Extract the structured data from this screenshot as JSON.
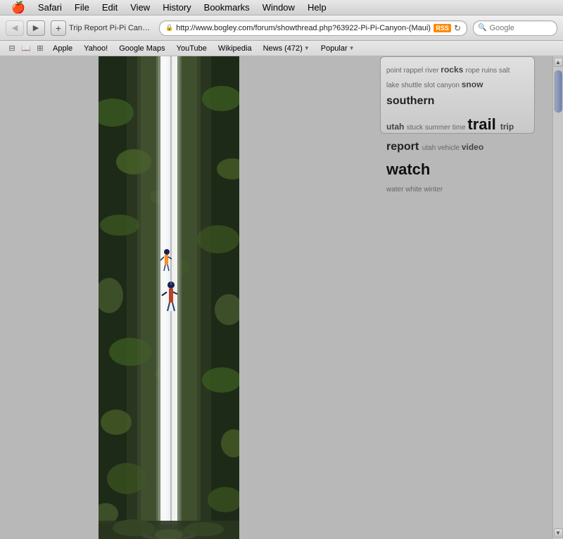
{
  "menubar": {
    "apple": "🍎",
    "items": [
      "Safari",
      "File",
      "Edit",
      "View",
      "History",
      "Bookmarks",
      "Window",
      "Help"
    ]
  },
  "toolbar": {
    "back_label": "◀",
    "forward_label": "▶",
    "plus_label": "+",
    "address": "http://www.bogley.com/forum/showthread.php?63922-Pi-Pi-Canyon-(Maui)",
    "rss_label": "RSS",
    "refresh_label": "↻",
    "search_placeholder": "Google",
    "title": "Trip Report Pi-Pi Canyon (Maui)"
  },
  "bookmarks": {
    "icon1": "⊞",
    "items": [
      "Apple",
      "Yahoo!",
      "Google Maps",
      "YouTube",
      "Wikipedia"
    ],
    "news_label": "News (472)",
    "popular_label": "Popular"
  },
  "tag_cloud": {
    "tags": [
      {
        "text": "point",
        "size": "sm"
      },
      {
        "text": "rappel",
        "size": "sm"
      },
      {
        "text": "river",
        "size": "sm"
      },
      {
        "text": "rocks",
        "size": "md"
      },
      {
        "text": "rope",
        "size": "sm"
      },
      {
        "text": "ruins",
        "size": "sm"
      },
      {
        "text": "salt",
        "size": "sm"
      },
      {
        "text": "lake",
        "size": "sm"
      },
      {
        "text": "shuttle",
        "size": "sm"
      },
      {
        "text": "slot",
        "size": "sm"
      },
      {
        "text": "canyon",
        "size": "sm"
      },
      {
        "text": "snow",
        "size": "md"
      },
      {
        "text": "southern",
        "size": "lg"
      },
      {
        "text": "utah",
        "size": "md"
      },
      {
        "text": "stuck",
        "size": "sm"
      },
      {
        "text": "summer",
        "size": "sm"
      },
      {
        "text": "time",
        "size": "sm"
      },
      {
        "text": "trail",
        "size": "xl"
      },
      {
        "text": "trip",
        "size": "md"
      },
      {
        "text": "report",
        "size": "lg"
      },
      {
        "text": "utah",
        "size": "sm"
      },
      {
        "text": "vehicle",
        "size": "sm"
      },
      {
        "text": "video",
        "size": "md"
      },
      {
        "text": "watch",
        "size": "xl"
      },
      {
        "text": "water",
        "size": "sm"
      },
      {
        "text": "white",
        "size": "sm"
      },
      {
        "text": "winter",
        "size": "sm"
      }
    ]
  }
}
